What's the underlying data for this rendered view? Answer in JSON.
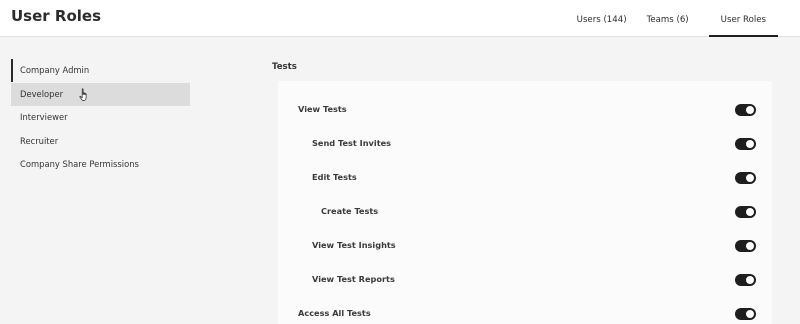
{
  "header": {
    "title": "User Roles",
    "tabs": [
      {
        "label": "Users (144)",
        "active": false
      },
      {
        "label": "Teams (6)",
        "active": false
      },
      {
        "label": "User Roles",
        "active": true
      }
    ]
  },
  "sidebar": {
    "roles": [
      {
        "label": "Company Admin",
        "state": "selected"
      },
      {
        "label": "Developer",
        "state": "hovered"
      },
      {
        "label": "Interviewer",
        "state": ""
      },
      {
        "label": "Recruiter",
        "state": ""
      },
      {
        "label": "Company Share Permissions",
        "state": ""
      }
    ]
  },
  "main": {
    "section_title": "Tests",
    "permissions": [
      {
        "label": "View Tests",
        "enabled": true,
        "level": 0
      },
      {
        "label": "Send Test Invites",
        "enabled": true,
        "level": 1
      },
      {
        "label": "Edit Tests",
        "enabled": true,
        "level": 1
      },
      {
        "label": "Create Tests",
        "enabled": true,
        "level": 2
      },
      {
        "label": "View Test Insights",
        "enabled": true,
        "level": 1
      },
      {
        "label": "View Test Reports",
        "enabled": true,
        "level": 1
      },
      {
        "label": "Access All Tests",
        "enabled": true,
        "level": 0
      }
    ]
  },
  "icons": {
    "cursor": "hand-pointer-icon",
    "toggle": "toggle-switch-icon"
  },
  "colors": {
    "toggle_on": "#1e1e1e",
    "selected_border": "#2a2a2a",
    "hover_bg": "#dcdcdc",
    "page_bg": "#f4f4f4"
  }
}
